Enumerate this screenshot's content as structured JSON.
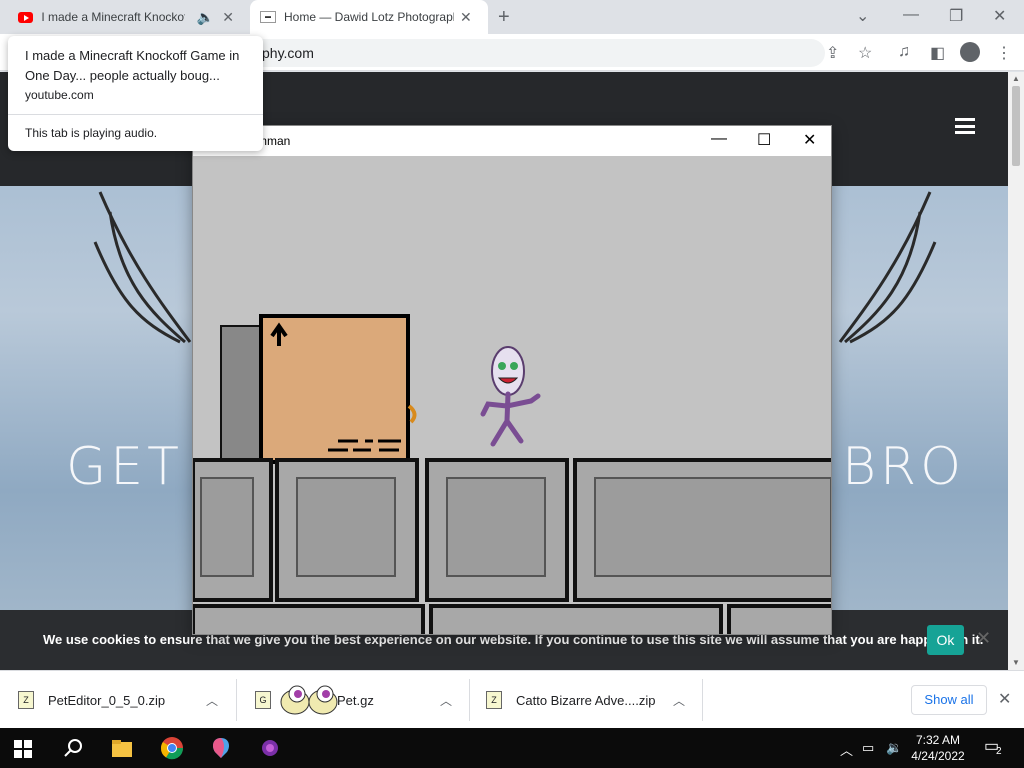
{
  "browser": {
    "tabs": [
      {
        "title": "I made a Minecraft Knockoff Game in One Day... people actually bought it",
        "short": "I made a Minecraft Knockoff",
        "active": false,
        "audio": true
      },
      {
        "title": "Home — Dawid Lotz Photography",
        "short": "Home — Dawid Lotz Photograpl",
        "active": true
      }
    ],
    "address": "phy.com",
    "tooltip": {
      "title": "I made a Minecraft Knockoff Game in One Day... people actually boug...",
      "url": "youtube.com",
      "audio_note": "This tab is playing audio."
    }
  },
  "website": {
    "hero_left": "GET",
    "hero_right": "BRO",
    "cookie_message": "We use cookies to ensure that we give you the best experience on our website. If you continue to use this site we will assume that you are happy with it.",
    "cookie_ok": "Ok"
  },
  "game_window": {
    "title": "Helphimman"
  },
  "downloads": {
    "items": [
      {
        "name": "PetEditor_0_5_0.zip"
      },
      {
        "name": "Pet.gz"
      },
      {
        "name": "Catto Bizarre Adve....zip"
      }
    ],
    "show_all": "Show all"
  },
  "taskbar": {
    "time": "7:32 AM",
    "date": "4/24/2022",
    "notifications": "2"
  },
  "colors": {
    "cookie_ok": "#16a396",
    "header": "#26282b",
    "link": "#1a73e8"
  }
}
